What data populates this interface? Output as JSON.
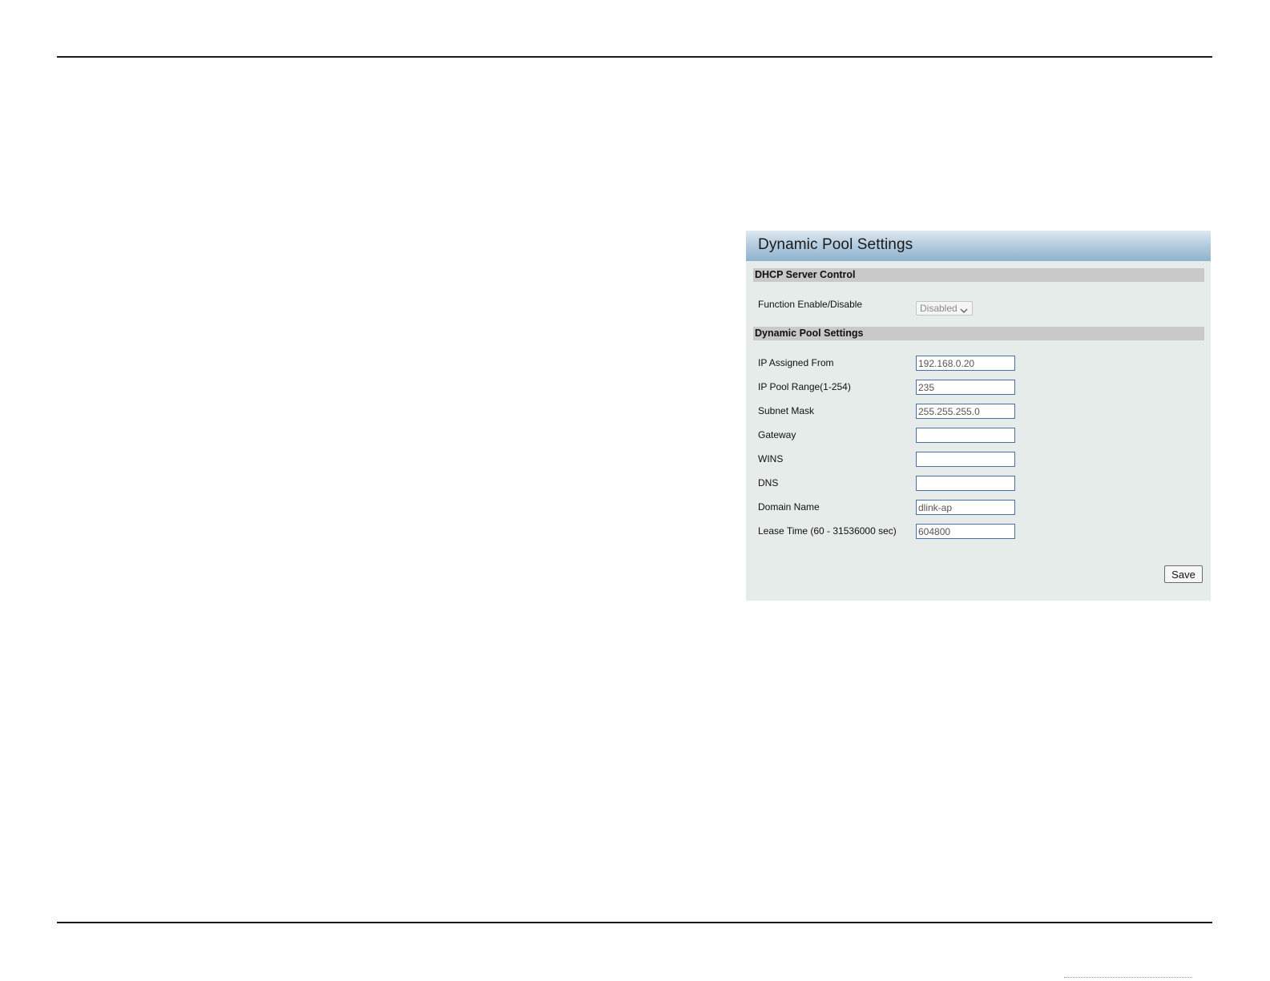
{
  "panel": {
    "title": "Dynamic Pool Settings"
  },
  "dhcp_control": {
    "heading": "DHCP Server Control",
    "function_label": "Function Enable/Disable",
    "function_value": "Disabled"
  },
  "pool": {
    "heading": "Dynamic Pool Settings",
    "fields": [
      {
        "label": "IP Assigned From",
        "value": "192.168.0.20"
      },
      {
        "label": "IP Pool Range(1-254)",
        "value": "235"
      },
      {
        "label": "Subnet Mask",
        "value": "255.255.255.0"
      },
      {
        "label": "Gateway",
        "value": ""
      },
      {
        "label": "WINS",
        "value": ""
      },
      {
        "label": "DNS",
        "value": ""
      },
      {
        "label": "Domain Name",
        "value": "dlink-ap"
      },
      {
        "label": "Lease Time (60 - 31536000 sec)",
        "value": "604800"
      }
    ]
  },
  "actions": {
    "save_label": "Save"
  },
  "icons": {
    "select_chevron": "chevron-down-icon"
  }
}
